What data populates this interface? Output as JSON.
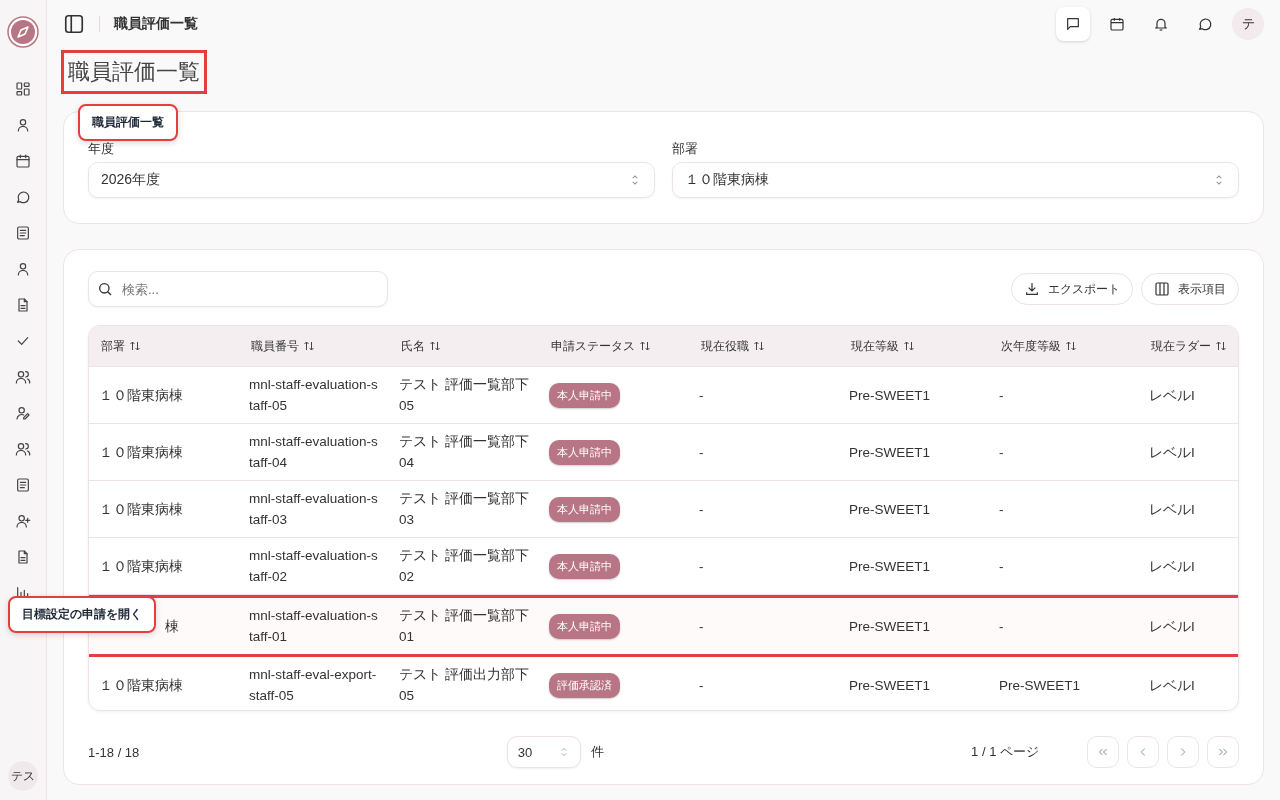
{
  "header": {
    "title": "職員評価一覧",
    "avatar": "テ"
  },
  "sidebar": {
    "avatar": "テス"
  },
  "page": {
    "heading": "職員評価一覧"
  },
  "filters": [
    {
      "label": "年度",
      "value": "2026年度"
    },
    {
      "label": "部署",
      "value": "１０階東病棟"
    }
  ],
  "search": {
    "placeholder": "検索..."
  },
  "actions": [
    "エクスポート",
    "表示項目"
  ],
  "table": {
    "columns": [
      "部署",
      "職員番号",
      "氏名",
      "申請ステータス",
      "現在役職",
      "現在等級",
      "次年度等級",
      "現在ラダー"
    ],
    "rows": [
      {
        "dept": "１０階東病棟",
        "staff_no": "mnl-staff-evaluation-staff-05",
        "name": "テスト 評価一覧部下05",
        "status": "本人申請中",
        "position": "-",
        "grade": "Pre-SWEET1",
        "next_grade": "-",
        "ladder": "レベルI",
        "highlighted": false
      },
      {
        "dept": "１０階東病棟",
        "staff_no": "mnl-staff-evaluation-staff-04",
        "name": "テスト 評価一覧部下04",
        "status": "本人申請中",
        "position": "-",
        "grade": "Pre-SWEET1",
        "next_grade": "-",
        "ladder": "レベルI",
        "highlighted": false
      },
      {
        "dept": "１０階東病棟",
        "staff_no": "mnl-staff-evaluation-staff-03",
        "name": "テスト 評価一覧部下03",
        "status": "本人申請中",
        "position": "-",
        "grade": "Pre-SWEET1",
        "next_grade": "-",
        "ladder": "レベルI",
        "highlighted": false
      },
      {
        "dept": "１０階東病棟",
        "staff_no": "mnl-staff-evaluation-staff-02",
        "name": "テスト 評価一覧部下02",
        "status": "本人申請中",
        "position": "-",
        "grade": "Pre-SWEET1",
        "next_grade": "-",
        "ladder": "レベルI",
        "highlighted": false
      },
      {
        "dept": "棟",
        "staff_no": "mnl-staff-evaluation-staff-01",
        "name": "テスト 評価一覧部下01",
        "status": "本人申請中",
        "position": "-",
        "grade": "Pre-SWEET1",
        "next_grade": "-",
        "ladder": "レベルI",
        "highlighted": true
      },
      {
        "dept": "１０階東病棟",
        "staff_no": "mnl-staff-eval-export-staff-05",
        "name": "テスト 評価出力部下05",
        "status": "評価承認済",
        "position": "-",
        "grade": "Pre-SWEET1",
        "next_grade": "Pre-SWEET1",
        "ladder": "レベルI",
        "highlighted": false
      }
    ]
  },
  "pagination": {
    "range": "1-18 / 18",
    "page_size": "30",
    "unit": "件",
    "page": "1 / 1 ページ"
  },
  "guide": {
    "title_tooltip": "職員評価一覧",
    "row_tooltip": "目標設定の申請を開く"
  }
}
